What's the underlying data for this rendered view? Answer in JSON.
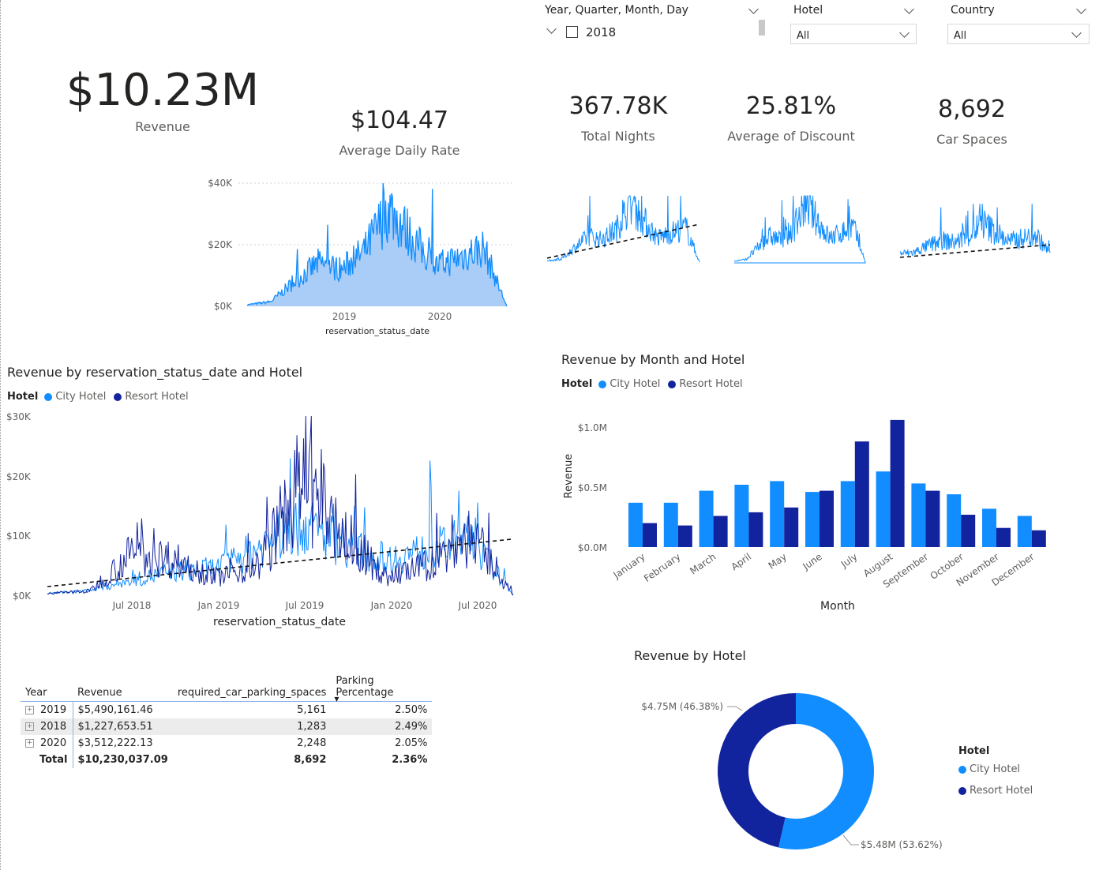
{
  "colors": {
    "city": "#118dff",
    "resort": "#12239e",
    "area": "#a9cdf7",
    "text": "#252423",
    "muted": "#605e5c",
    "grid": "#d0d0d0"
  },
  "slicers": {
    "date": {
      "title": "Year, Quarter, Month, Day",
      "item": "2018"
    },
    "hotel": {
      "title": "Hotel",
      "value": "All"
    },
    "country": {
      "title": "Country",
      "value": "All"
    }
  },
  "kpis": {
    "revenue": {
      "value": "$10.23M",
      "label": "Revenue"
    },
    "adr": {
      "value": "$104.47",
      "label": "Average Daily Rate"
    },
    "nights": {
      "value": "367.78K",
      "label": "Total Nights"
    },
    "discount": {
      "value": "25.81%",
      "label": "Average of Discount"
    },
    "parking": {
      "value": "8,692",
      "label": "Car Spaces"
    }
  },
  "area_chart": {
    "y_ticks": [
      "$40K",
      "$20K",
      "$0K"
    ],
    "x_ticks": [
      "2019",
      "2020"
    ],
    "xlabel": "reservation_status_date"
  },
  "line_chart": {
    "title": "Revenue by reservation_status_date and Hotel",
    "legend_title": "Hotel",
    "legend": [
      "City Hotel",
      "Resort Hotel"
    ],
    "y_ticks": [
      "$30K",
      "$20K",
      "$10K",
      "$0K"
    ],
    "x_ticks": [
      "Jul 2018",
      "Jan 2019",
      "Jul 2019",
      "Jan 2020",
      "Jul 2020"
    ],
    "xlabel": "reservation_status_date"
  },
  "bar_chart": {
    "title": "Revenue by Month and Hotel",
    "legend_title": "Hotel",
    "legend": [
      "City Hotel",
      "Resort Hotel"
    ],
    "y_ticks": [
      "$1.0M",
      "$0.5M",
      "$0.0M"
    ],
    "ylabel": "Revenue",
    "xlabel": "Month"
  },
  "donut": {
    "title": "Revenue by Hotel",
    "legend_title": "Hotel",
    "legend": [
      "City Hotel",
      "Resort Hotel"
    ],
    "label_resort": "$4.75M (46.38%)",
    "label_city": "$5.48M (53.62%)"
  },
  "matrix": {
    "headers": [
      "Year",
      "Revenue",
      "required_car_parking_spaces",
      "Parking Percentage"
    ],
    "rows": [
      {
        "year": "2019",
        "revenue": "$5,490,161.46",
        "spaces": "5,161",
        "pct": "2.50%"
      },
      {
        "year": "2018",
        "revenue": "$1,227,653.51",
        "spaces": "1,283",
        "pct": "2.49%"
      },
      {
        "year": "2020",
        "revenue": "$3,512,222.13",
        "spaces": "2,248",
        "pct": "2.05%"
      }
    ],
    "total": {
      "label": "Total",
      "revenue": "$10,230,037.09",
      "spaces": "8,692",
      "pct": "2.36%"
    }
  },
  "chart_data": [
    {
      "type": "area",
      "title": "",
      "xlabel": "reservation_status_date",
      "ylabel": "",
      "ylim": [
        0,
        40000
      ],
      "x": [
        "2018-01",
        "2018-04",
        "2018-07",
        "2018-10",
        "2019-01",
        "2019-04",
        "2019-07",
        "2019-10",
        "2020-01",
        "2020-04",
        "2020-07",
        "2020-09"
      ],
      "series": [
        {
          "values": [
            500,
            1500,
            8000,
            14000,
            12000,
            18000,
            32000,
            22000,
            13000,
            16000,
            19000,
            0
          ]
        }
      ],
      "x_ticks": [
        "2019",
        "2020"
      ],
      "y_ticks": [
        "$0K",
        "$20K",
        "$40K"
      ],
      "grid": true
    },
    {
      "type": "line",
      "title": "Revenue by reservation_status_date and Hotel",
      "xlabel": "reservation_status_date",
      "ylabel": "",
      "ylim": [
        0,
        30000
      ],
      "x": [
        "2018-01",
        "2018-04",
        "2018-07",
        "2018-10",
        "2019-01",
        "2019-04",
        "2019-07",
        "2019-10",
        "2020-01",
        "2020-04",
        "2020-07",
        "2020-09"
      ],
      "series": [
        {
          "name": "City Hotel",
          "values": [
            300,
            800,
            2500,
            4000,
            4500,
            8000,
            12000,
            8500,
            6000,
            7500,
            9500,
            0
          ]
        },
        {
          "name": "Resort Hotel",
          "values": [
            300,
            700,
            7000,
            6000,
            3000,
            5000,
            19000,
            10000,
            3000,
            5000,
            10000,
            0
          ]
        }
      ],
      "trendline": true,
      "legend": "top-left",
      "x_ticks": [
        "Jul 2018",
        "Jan 2019",
        "Jul 2019",
        "Jan 2020",
        "Jul 2020"
      ],
      "y_ticks": [
        "$0K",
        "$10K",
        "$20K",
        "$30K"
      ]
    },
    {
      "type": "bar",
      "title": "Revenue by Month and Hotel",
      "xlabel": "Month",
      "ylabel": "Revenue",
      "ylim": [
        0,
        1.1
      ],
      "unit": "$M",
      "categories": [
        "January",
        "February",
        "March",
        "April",
        "May",
        "June",
        "July",
        "August",
        "September",
        "October",
        "November",
        "December"
      ],
      "series": [
        {
          "name": "City Hotel",
          "values": [
            0.37,
            0.37,
            0.47,
            0.52,
            0.55,
            0.46,
            0.55,
            0.63,
            0.53,
            0.44,
            0.32,
            0.26
          ]
        },
        {
          "name": "Resort Hotel",
          "values": [
            0.2,
            0.18,
            0.26,
            0.29,
            0.33,
            0.47,
            0.88,
            1.06,
            0.47,
            0.27,
            0.16,
            0.14
          ]
        }
      ],
      "legend": "top-left"
    },
    {
      "type": "pie",
      "donut": true,
      "title": "Revenue by Hotel",
      "categories": [
        "City Hotel",
        "Resort Hotel"
      ],
      "values": [
        5.48,
        4.75
      ],
      "percent": [
        53.62,
        46.38
      ],
      "unit": "$M",
      "legend": "right"
    }
  ]
}
